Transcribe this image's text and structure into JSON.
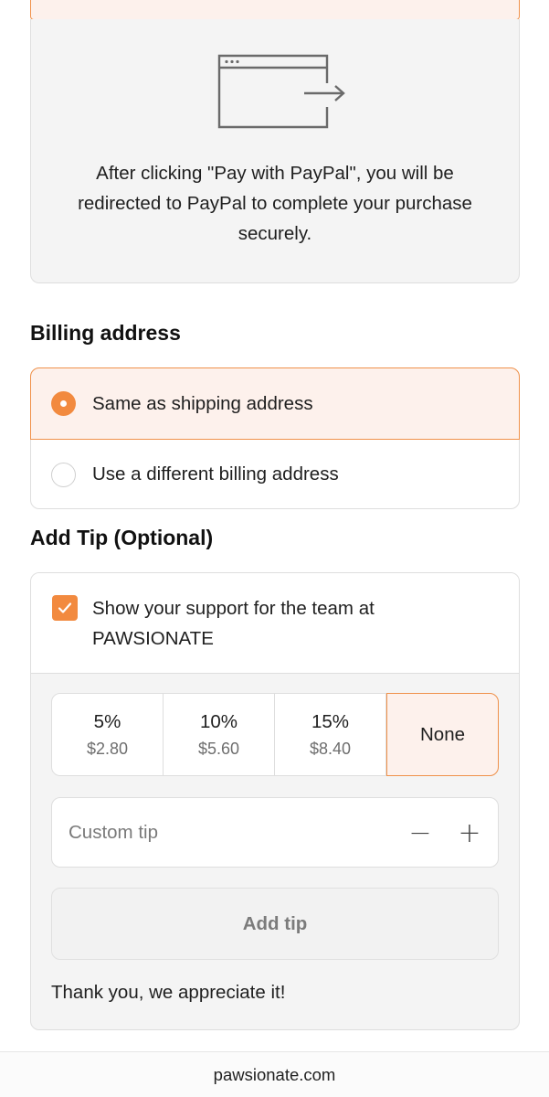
{
  "paypal_panel": {
    "icon": "browser-redirect-icon",
    "message": "After clicking \"Pay with PayPal\", you will be redirected to PayPal to complete your purchase securely."
  },
  "billing": {
    "title": "Billing address",
    "options": [
      {
        "label": "Same as shipping address",
        "selected": true
      },
      {
        "label": "Use a different billing address",
        "selected": false
      }
    ]
  },
  "tip": {
    "title": "Add Tip (Optional)",
    "checkbox_label": "Show your support for the team at PAWSIONATE",
    "checkbox_checked": true,
    "options": [
      {
        "percent": "5%",
        "amount": "$2.80"
      },
      {
        "percent": "10%",
        "amount": "$5.60"
      },
      {
        "percent": "15%",
        "amount": "$8.40"
      },
      {
        "percent": "None",
        "amount": ""
      }
    ],
    "selected_option": "None",
    "custom_placeholder": "Custom tip",
    "custom_value": "",
    "minus_label": "−",
    "plus_label": "+",
    "add_button_label": "Add tip",
    "thanks_message": "Thank you, we appreciate it!"
  },
  "footer": {
    "domain": "pawsionate.com"
  },
  "colors": {
    "accent": "#f28a3f",
    "accent_border": "#f0914a",
    "selected_bg": "#fdf1ec",
    "panel_bg": "#f4f4f4"
  }
}
